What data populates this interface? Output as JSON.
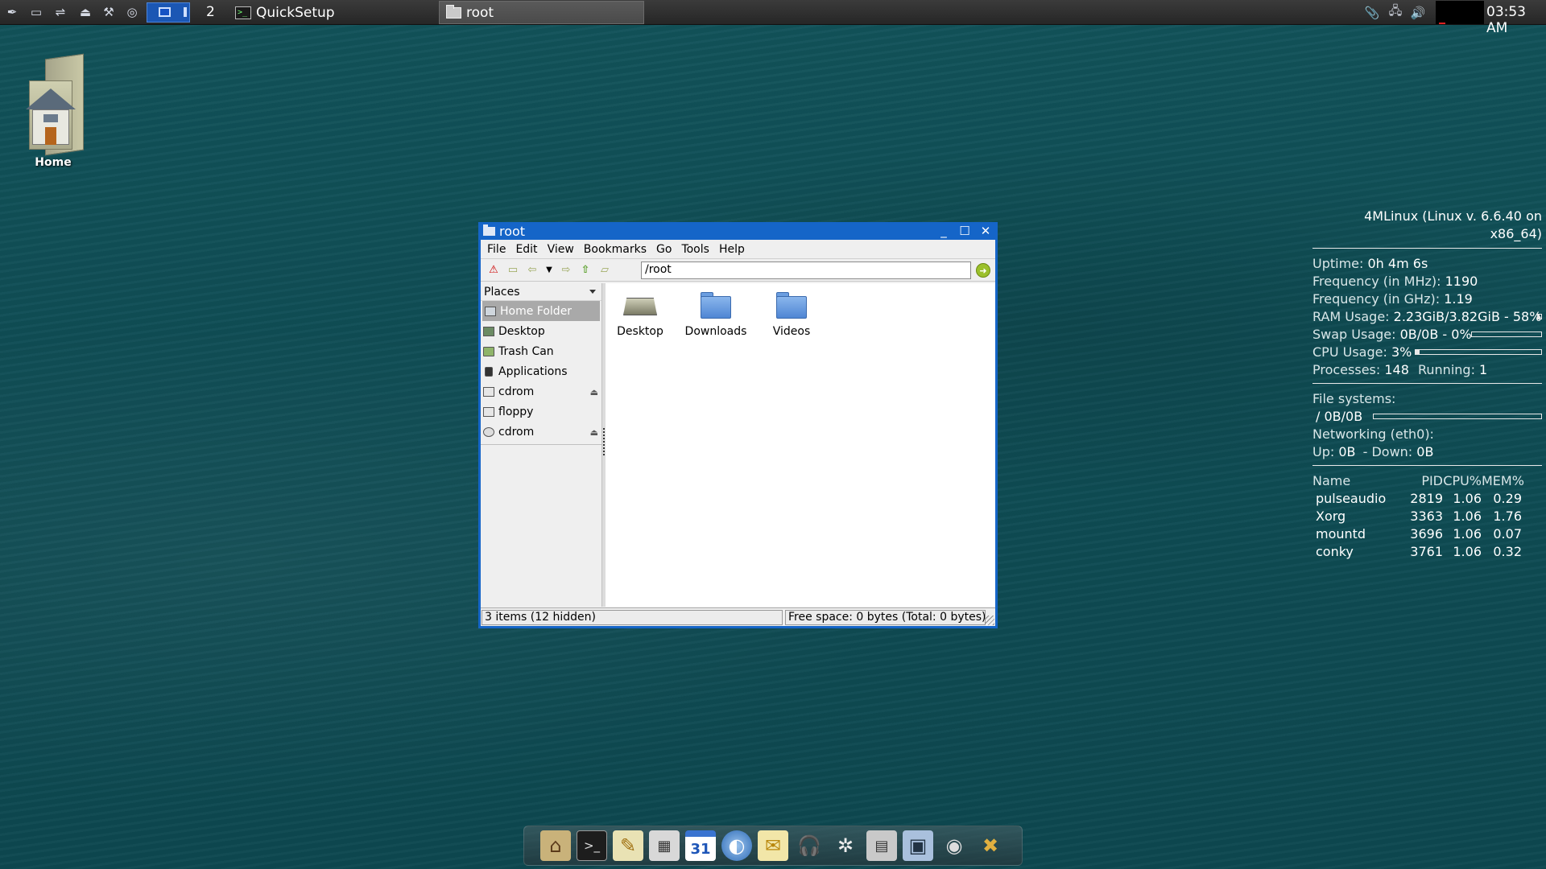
{
  "panel": {
    "launcher_icons": [
      "feather-icon",
      "drive-icon",
      "usb-icon",
      "eject-icon",
      "mount-icon",
      "refresh-icon"
    ],
    "workspace_number": "2",
    "tasks": [
      {
        "label": "QuickSetup",
        "icon": "terminal-icon"
      },
      {
        "label": "root",
        "icon": "folder-icon"
      }
    ],
    "clock": "03:53 AM"
  },
  "desktop": {
    "home_label": "Home"
  },
  "window": {
    "title": "root",
    "menu": [
      "File",
      "Edit",
      "View",
      "Bookmarks",
      "Go",
      "Tools",
      "Help"
    ],
    "location": "/root",
    "places_label": "Places",
    "places": [
      {
        "label": "Home Folder",
        "icon": "home-folder-icon",
        "selected": true
      },
      {
        "label": "Desktop",
        "icon": "desktop-icon"
      },
      {
        "label": "Trash Can",
        "icon": "trash-icon"
      },
      {
        "label": "Applications",
        "icon": "applications-icon"
      },
      {
        "label": "cdrom",
        "icon": "drive-icon",
        "eject": true
      },
      {
        "label": "floppy",
        "icon": "floppy-icon"
      },
      {
        "label": "cdrom",
        "icon": "disc-icon",
        "eject": true
      }
    ],
    "files": [
      {
        "label": "Desktop",
        "icon": "desktop-folder-icon"
      },
      {
        "label": "Downloads",
        "icon": "folder-icon"
      },
      {
        "label": "Videos",
        "icon": "folder-icon"
      }
    ],
    "status_left": "3 items (12 hidden)",
    "status_right": "Free space: 0 bytes (Total: 0 bytes)"
  },
  "conky": {
    "header": "4MLinux (Linux v. 6.6.40 on x86_64)",
    "uptime_label": "Uptime:",
    "uptime": "0h 4m 6s",
    "freq_mhz_label": "Frequency (in MHz):",
    "freq_mhz": "1190",
    "freq_ghz_label": "Frequency (in GHz):",
    "freq_ghz": "1.19",
    "ram_label": "RAM Usage:",
    "ram": "2.23GiB/3.82GiB - 58%",
    "ram_pct": 58,
    "swap_label": "Swap Usage:",
    "swap": "0B/0B - 0%",
    "swap_pct": 0,
    "cpu_label": "CPU Usage:",
    "cpu": "3%",
    "cpu_pct": 3,
    "processes_label": "Processes:",
    "processes": "148",
    "running_label": "Running:",
    "running": "1",
    "fs_label": "File systems:",
    "fs_root": "/ 0B/0B",
    "fs_pct": 0,
    "net_label": "Networking (eth0):",
    "up_label": "Up:",
    "up": "0B",
    "down_label": "- Down:",
    "down": "0B",
    "proc_headers": [
      "Name",
      "PID",
      "CPU%",
      "MEM%"
    ],
    "procs": [
      {
        "name": "pulseaudio",
        "pid": "2819",
        "cpu": "1.06",
        "mem": "0.29"
      },
      {
        "name": "Xorg",
        "pid": "3363",
        "cpu": "1.06",
        "mem": "1.76"
      },
      {
        "name": "mountd",
        "pid": "3696",
        "cpu": "1.06",
        "mem": "0.07"
      },
      {
        "name": "conky",
        "pid": "3761",
        "cpu": "1.06",
        "mem": "0.32"
      }
    ]
  },
  "dock": {
    "items": [
      "file-manager-icon",
      "terminal-icon",
      "text-editor-icon",
      "calculator-icon",
      "calendar-icon",
      "web-browser-icon",
      "mail-icon",
      "headphones-icon",
      "video-player-icon",
      "scanner-icon",
      "camera-icon",
      "webcam-icon",
      "settings-tools-icon"
    ],
    "calendar_day": "31"
  }
}
